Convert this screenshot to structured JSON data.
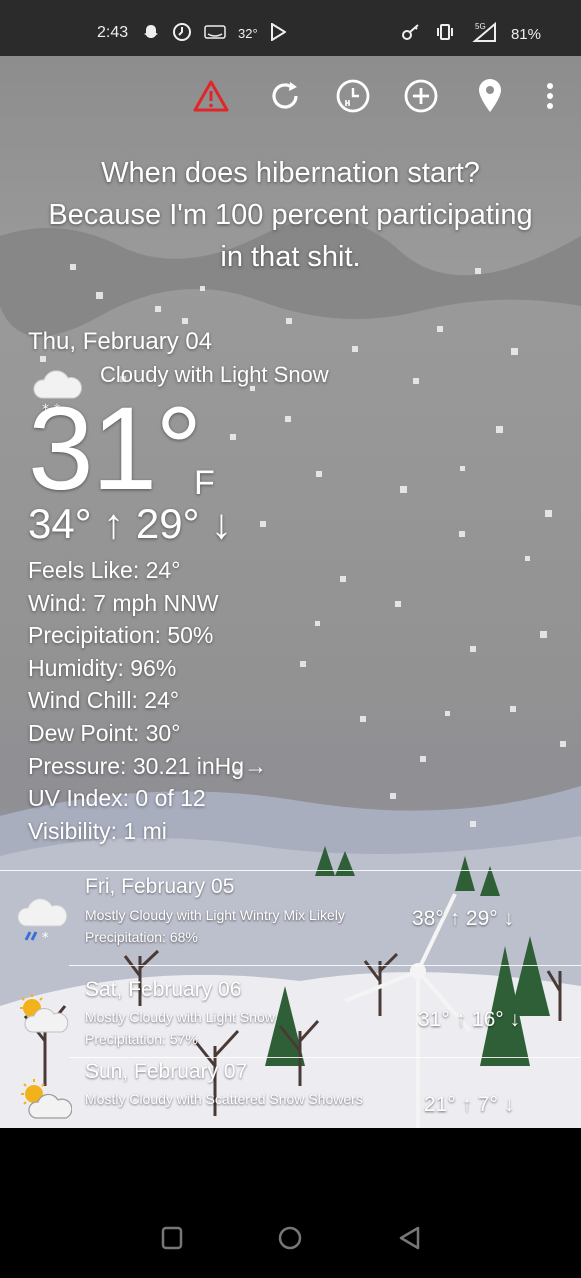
{
  "status_bar": {
    "time": "2:43",
    "temp_badge": "32°",
    "battery": "81%",
    "network": "5G",
    "left_icons": [
      "snapchat-icon",
      "clock-icon",
      "amazon-icon",
      "play-store-icon"
    ],
    "right_icons": [
      "key-icon",
      "vibrate-icon",
      "signal-icon"
    ]
  },
  "toolbar": {
    "icons": [
      "alert-icon",
      "refresh-icon",
      "history-icon",
      "add-location-icon",
      "location-pin-icon",
      "more-icon"
    ],
    "alert_color": "#e0262b"
  },
  "quote": {
    "line1": "When does hibernation start?",
    "line2": "Because I'm 100 percent participating",
    "line3": "in that shit."
  },
  "current": {
    "date": "Thu, February 04",
    "condition": "Cloudy with Light Snow",
    "temp": "31°",
    "unit": "F",
    "high_low": "34° ↑  29° ↓",
    "details": [
      "Feels Like: 24°",
      "Wind: 7 mph NNW",
      "Precipitation: 50%",
      "Humidity: 96%",
      "Wind Chill: 24°",
      "Dew Point: 30°",
      "Pressure: 30.21 inHg→",
      "UV Index: 0 of 12",
      "Visibility: 1 mi"
    ]
  },
  "forecast": [
    {
      "day": "Fri, February 05",
      "description": "Mostly Cloudy with Light Wintry Mix Likely",
      "precipitation": "Precipitation: 68%",
      "temps": "38° ↑  29° ↓",
      "icon": "cloud-wintry-mix-icon"
    },
    {
      "day": "Sat, February 06",
      "description": "Mostly Cloudy with Light Snow",
      "precipitation": "Precipitation: 57%",
      "temps": "31° ↑  16° ↓",
      "icon": "partly-sunny-cloud-icon"
    },
    {
      "day": "Sun, February 07",
      "description": "Mostly Cloudy with Scattered Snow Showers",
      "precipitation": "",
      "temps": "21° ↑  7° ↓",
      "icon": "sun-cloud-icon"
    }
  ],
  "navbar": {
    "icons": [
      "recents-button-icon",
      "home-button-icon",
      "back-button-icon"
    ]
  }
}
